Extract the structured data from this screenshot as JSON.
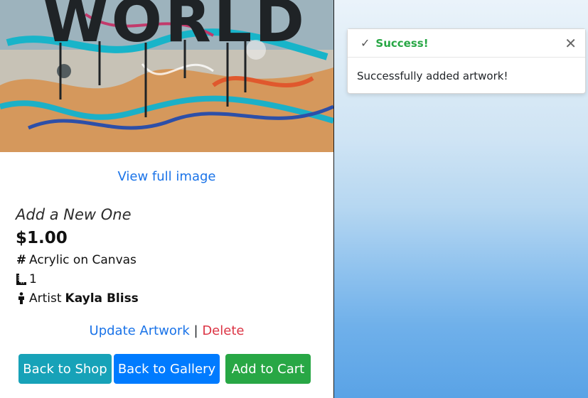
{
  "artwork": {
    "image_text": "WORLD",
    "view_link": "View full image",
    "title": "Add a New One",
    "price": "$1.00",
    "medium": "Acrylic on Canvas",
    "size": "1",
    "artist_label": "Artist",
    "artist_name": "Kayla Bliss"
  },
  "actions": {
    "update": "Update Artwork",
    "separator": "|",
    "delete": "Delete"
  },
  "buttons": {
    "back_shop": "Back to Shop",
    "back_gallery": "Back to Gallery",
    "add_cart": "Add to Cart"
  },
  "toast": {
    "title": "Success!",
    "message": "Successfully added artwork!",
    "icon": "check-icon",
    "close_icon": "close-icon"
  },
  "colors": {
    "link": "#1a73e8",
    "delete": "#dc3545",
    "shop_button": "#17a2b8",
    "gallery_button": "#007bff",
    "cart_button": "#28a745",
    "success": "#28a745"
  }
}
